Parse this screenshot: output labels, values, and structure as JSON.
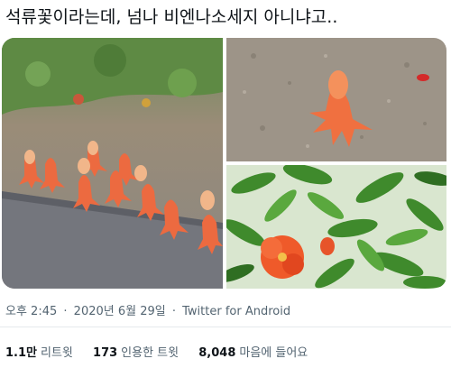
{
  "tweet": {
    "text": "석류꽃이라는데, 넘나 비엔나소세지 아니냐고..",
    "time": "오후 2:45",
    "dot": "·",
    "date": "2020년 6월 29일",
    "source": "Twitter for Android"
  },
  "stats": {
    "retweets_value": "1.1만",
    "retweets_label": "리트윗",
    "quotes_value": "173",
    "quotes_label": "인용한 트윗",
    "likes_value": "8,048",
    "likes_label": "마음에 들어요"
  },
  "colors": {
    "flower": "#f06a3e",
    "leaf": "#3f8a2c",
    "ground": "#a09a8e",
    "meta_text": "#536471"
  }
}
